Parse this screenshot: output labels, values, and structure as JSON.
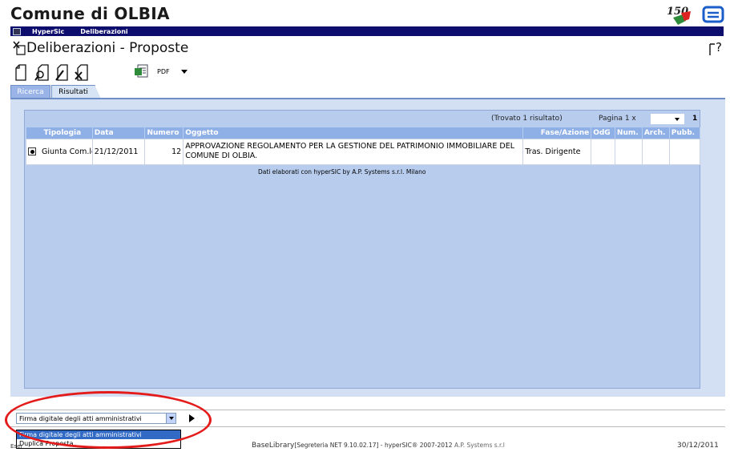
{
  "app": {
    "title": "Comune di OLBIA",
    "menu": [
      "HyperSic",
      "Deliberazioni"
    ],
    "page_title": "Deliberazioni - Proposte",
    "logo_text": "150"
  },
  "toolbar": {
    "export_format": "PDF",
    "icons": [
      "new-document-icon",
      "search-document-icon",
      "edit-document-icon",
      "delete-document-icon",
      "export-icon"
    ]
  },
  "tabs": [
    {
      "label": "Ricerca",
      "active": false
    },
    {
      "label": "Risultati",
      "active": true
    }
  ],
  "results": {
    "summary": "(Trovato 1 risultato)",
    "page_label": "Pagina 1  x",
    "page_total": "1",
    "columns": [
      "Tipologia",
      "Data",
      "Numero",
      "Oggetto",
      "Fase/Azione",
      "OdG",
      "Num.",
      "Arch.",
      "Pubb."
    ],
    "rows": [
      {
        "tipologia": "Giunta Com.le",
        "data": "21/12/2011",
        "numero": "12",
        "oggetto": "APPROVAZIONE REGOLAMENTO PER LA GESTIONE DEL PATRIMONIO IMMOBILIARE DEL COMUNE DI OLBIA.",
        "fase": "Tras. Dirigente",
        "odg": "",
        "num": "",
        "arch": "",
        "pubb": ""
      }
    ],
    "footer_note": "Dati elaborati con hyperSIC by A.P. Systems s.r.l. Milano"
  },
  "actions": {
    "selected": "Firma digitale degli atti amministrativi",
    "options": [
      "Firma digitale degli atti amministrativi",
      "Duplica Proposta"
    ]
  },
  "status": {
    "left": "Eser",
    "library": "BaseLibrary",
    "version": "[Segreteria NET 9.10.02.17]",
    "copyright_main": " -  hyperSIC® 2007-2012 ",
    "copyright_company": "A.P. Systems s.r.l",
    "date": "30/12/2011"
  },
  "colors": {
    "menubar": "#0d0d6e",
    "panel": "#d3e0f4",
    "inner": "#b8cdee",
    "header": "#8fb0e6",
    "highlight": "#316ac5",
    "annotation": "#e41b1b"
  }
}
